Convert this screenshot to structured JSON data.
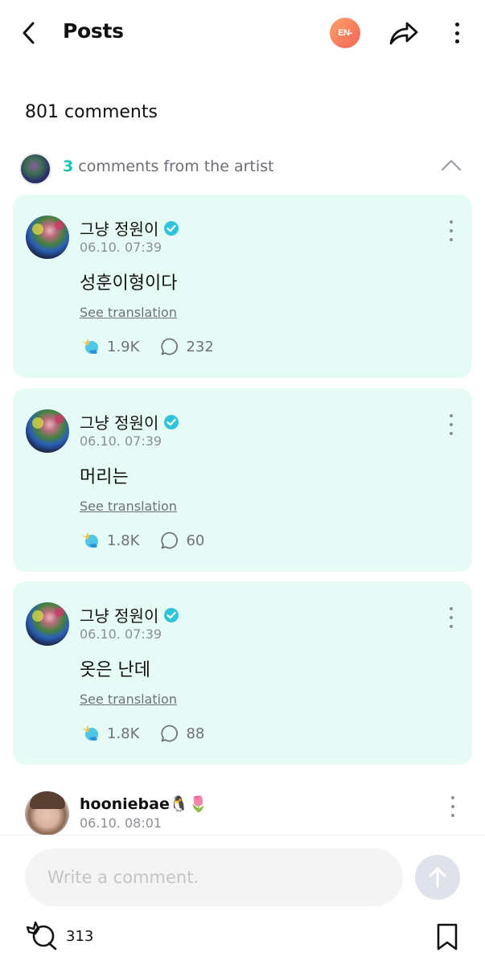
{
  "header": {
    "title": "Posts",
    "community_badge": "EN-"
  },
  "comments_count": "801 comments",
  "artist_section": {
    "count": "3",
    "label": " comments from the artist"
  },
  "artist_comments": [
    {
      "name": "그냥 정원이",
      "date": "06.10. 07:39",
      "text": "성훈이형이다",
      "translate": "See translation",
      "likes": "1.9K",
      "replies": "232"
    },
    {
      "name": "그냥 정원이",
      "date": "06.10. 07:39",
      "text": "머리는",
      "translate": "See translation",
      "likes": "1.8K",
      "replies": "60"
    },
    {
      "name": "그냥 정원이",
      "date": "06.10. 07:39",
      "text": "옷은 난데",
      "translate": "See translation",
      "likes": "1.8K",
      "replies": "88"
    }
  ],
  "user_comment": {
    "name": "hooniebae🐧🌷",
    "date": "06.10. 08:01"
  },
  "composer": {
    "placeholder": "Write a comment.",
    "post_likes": "313"
  },
  "colors": {
    "accent": "#17c3b2",
    "card_bg": "#e7fbf6",
    "badge_gradient_start": "#ff9f6a",
    "badge_gradient_end": "#f26456"
  },
  "icons": {
    "back": "chevron-left-icon",
    "share": "share-arrow-icon",
    "more": "vertical-dots-icon",
    "collapse": "chevron-up-icon",
    "verified": "verified-badge-icon",
    "cheer": "cheer-icon",
    "reply": "speech-bubble-icon",
    "send": "arrow-up-icon",
    "bookmark": "bookmark-icon"
  }
}
